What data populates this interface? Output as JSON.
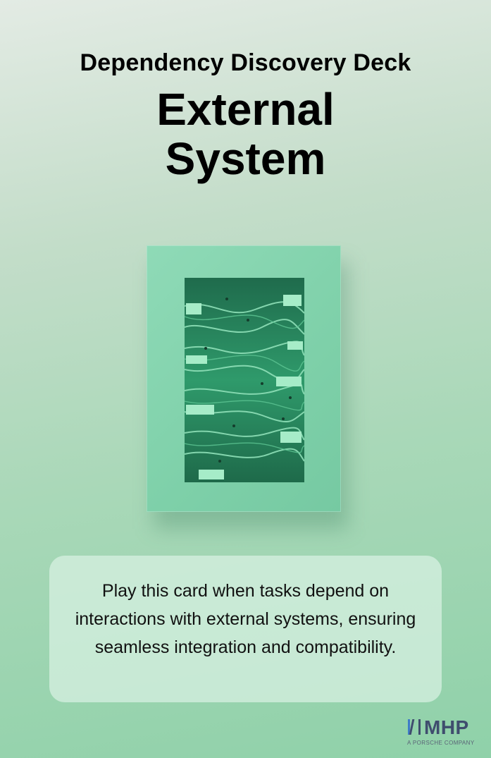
{
  "deck_title": "Dependency Discovery Deck",
  "card_title_line1": "External",
  "card_title_line2": "System",
  "description": "Play this card when tasks depend on interactions with external systems, ensuring seamless integration and compatibility.",
  "logo": {
    "name": "MHP",
    "tagline": "A PORSCHE COMPANY"
  },
  "colors": {
    "accent_green": "#8fd1a9",
    "logo_blue": "#3f4d6e"
  },
  "icons": [
    "circuit-frame-illustration",
    "mhp-logo-icon"
  ]
}
